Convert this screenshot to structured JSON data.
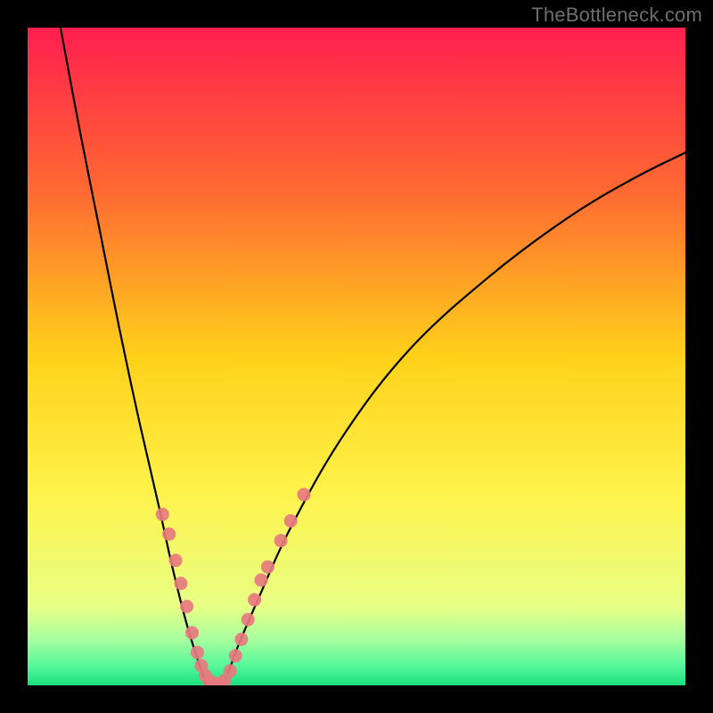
{
  "watermark": "TheBottleneck.com",
  "chart_data": {
    "type": "line",
    "title": "",
    "xlabel": "",
    "ylabel": "",
    "xlim": [
      0,
      100
    ],
    "ylim": [
      0,
      100
    ],
    "grid": false,
    "legend": false,
    "gradient_stops": [
      {
        "offset": 0.0,
        "color": "#ff1f4f"
      },
      {
        "offset": 0.25,
        "color": "#ff6a32"
      },
      {
        "offset": 0.5,
        "color": "#ffd11a"
      },
      {
        "offset": 0.7,
        "color": "#fff249"
      },
      {
        "offset": 0.88,
        "color": "#e8ff85"
      },
      {
        "offset": 0.93,
        "color": "#a8ff9f"
      },
      {
        "offset": 0.97,
        "color": "#56f79a"
      },
      {
        "offset": 1.0,
        "color": "#19e07d"
      }
    ],
    "series": [
      {
        "name": "left-branch",
        "x": [
          5,
          8,
          11,
          14,
          17,
          20,
          22,
          24,
          25.5,
          26.5,
          27.2
        ],
        "y": [
          100,
          84,
          69,
          54,
          40,
          27,
          18,
          10,
          5,
          2,
          0
        ]
      },
      {
        "name": "right-branch",
        "x": [
          29.5,
          30.5,
          32,
          35,
          40,
          48,
          58,
          70,
          82,
          92,
          100
        ],
        "y": [
          0,
          2,
          6,
          13,
          24,
          38,
          51,
          62,
          71,
          77,
          81
        ]
      }
    ],
    "scatter_points": {
      "name": "markers",
      "color": "#e77a7f",
      "points": [
        {
          "x": 20.5,
          "y": 26
        },
        {
          "x": 21.5,
          "y": 23
        },
        {
          "x": 22.5,
          "y": 19
        },
        {
          "x": 23.3,
          "y": 15.5
        },
        {
          "x": 24.2,
          "y": 12
        },
        {
          "x": 25.0,
          "y": 8
        },
        {
          "x": 25.8,
          "y": 5
        },
        {
          "x": 26.4,
          "y": 3
        },
        {
          "x": 27.0,
          "y": 1.5
        },
        {
          "x": 27.6,
          "y": 0.7
        },
        {
          "x": 28.4,
          "y": 0.3
        },
        {
          "x": 29.3,
          "y": 0.3
        },
        {
          "x": 30.0,
          "y": 0.8
        },
        {
          "x": 30.8,
          "y": 2.2
        },
        {
          "x": 31.6,
          "y": 4.5
        },
        {
          "x": 32.5,
          "y": 7
        },
        {
          "x": 33.5,
          "y": 10
        },
        {
          "x": 34.5,
          "y": 13
        },
        {
          "x": 35.5,
          "y": 16
        },
        {
          "x": 36.5,
          "y": 18
        },
        {
          "x": 38.5,
          "y": 22
        },
        {
          "x": 40.0,
          "y": 25
        },
        {
          "x": 42.0,
          "y": 29
        }
      ]
    }
  }
}
